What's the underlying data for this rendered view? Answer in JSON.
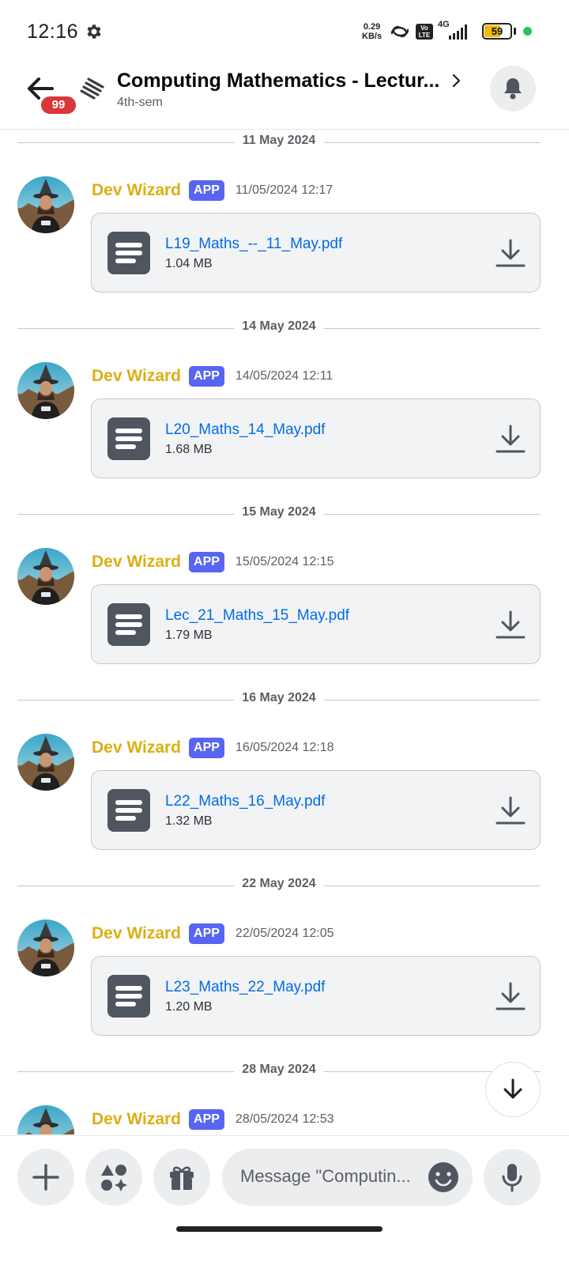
{
  "status_bar": {
    "time": "12:16",
    "speed_value": "0.29",
    "speed_unit": "KB/s",
    "network": "4G",
    "volte": "Vo LTE",
    "battery": "59"
  },
  "header": {
    "unread_count": "99",
    "title": "Computing Mathematics - Lectur...",
    "subtitle": "4th-sem"
  },
  "messages": [
    {
      "date": "11 May 2024",
      "author": "Dev Wizard",
      "tag": "APP",
      "timestamp": "11/05/2024 12:17",
      "file_name": "L19_Maths_--_11_May.pdf",
      "file_size": "1.04 MB"
    },
    {
      "date": "14 May 2024",
      "author": "Dev Wizard",
      "tag": "APP",
      "timestamp": "14/05/2024 12:11",
      "file_name": "L20_Maths_14_May.pdf",
      "file_size": "1.68 MB"
    },
    {
      "date": "15 May 2024",
      "author": "Dev Wizard",
      "tag": "APP",
      "timestamp": "15/05/2024 12:15",
      "file_name": "Lec_21_Maths_15_May.pdf",
      "file_size": "1.79 MB"
    },
    {
      "date": "16 May 2024",
      "author": "Dev Wizard",
      "tag": "APP",
      "timestamp": "16/05/2024 12:18",
      "file_name": "L22_Maths_16_May.pdf",
      "file_size": "1.32 MB"
    },
    {
      "date": "22 May 2024",
      "author": "Dev Wizard",
      "tag": "APP",
      "timestamp": "22/05/2024 12:05",
      "file_name": "L23_Maths_22_May.pdf",
      "file_size": "1.20 MB"
    },
    {
      "date": "28 May 2024",
      "author": "Dev Wizard",
      "tag": "APP",
      "timestamp": "28/05/2024 12:53",
      "file_name": "",
      "file_size": ""
    }
  ],
  "composer": {
    "placeholder": "Message \"Computin..."
  },
  "colors": {
    "author": "#dcae14",
    "app_tag": "#5865f2",
    "file_link": "#006ce7",
    "badge": "#da373c"
  },
  "icons": {
    "back": "arrow-left-icon",
    "channel": "forum-channel-icon",
    "bell": "bell-icon",
    "download": "download-icon",
    "file": "file-document-icon",
    "scroll_down": "arrow-down-icon",
    "add": "plus-icon",
    "apps": "apps-icon",
    "gift": "gift-icon",
    "emoji": "emoji-icon",
    "mic": "microphone-icon"
  }
}
